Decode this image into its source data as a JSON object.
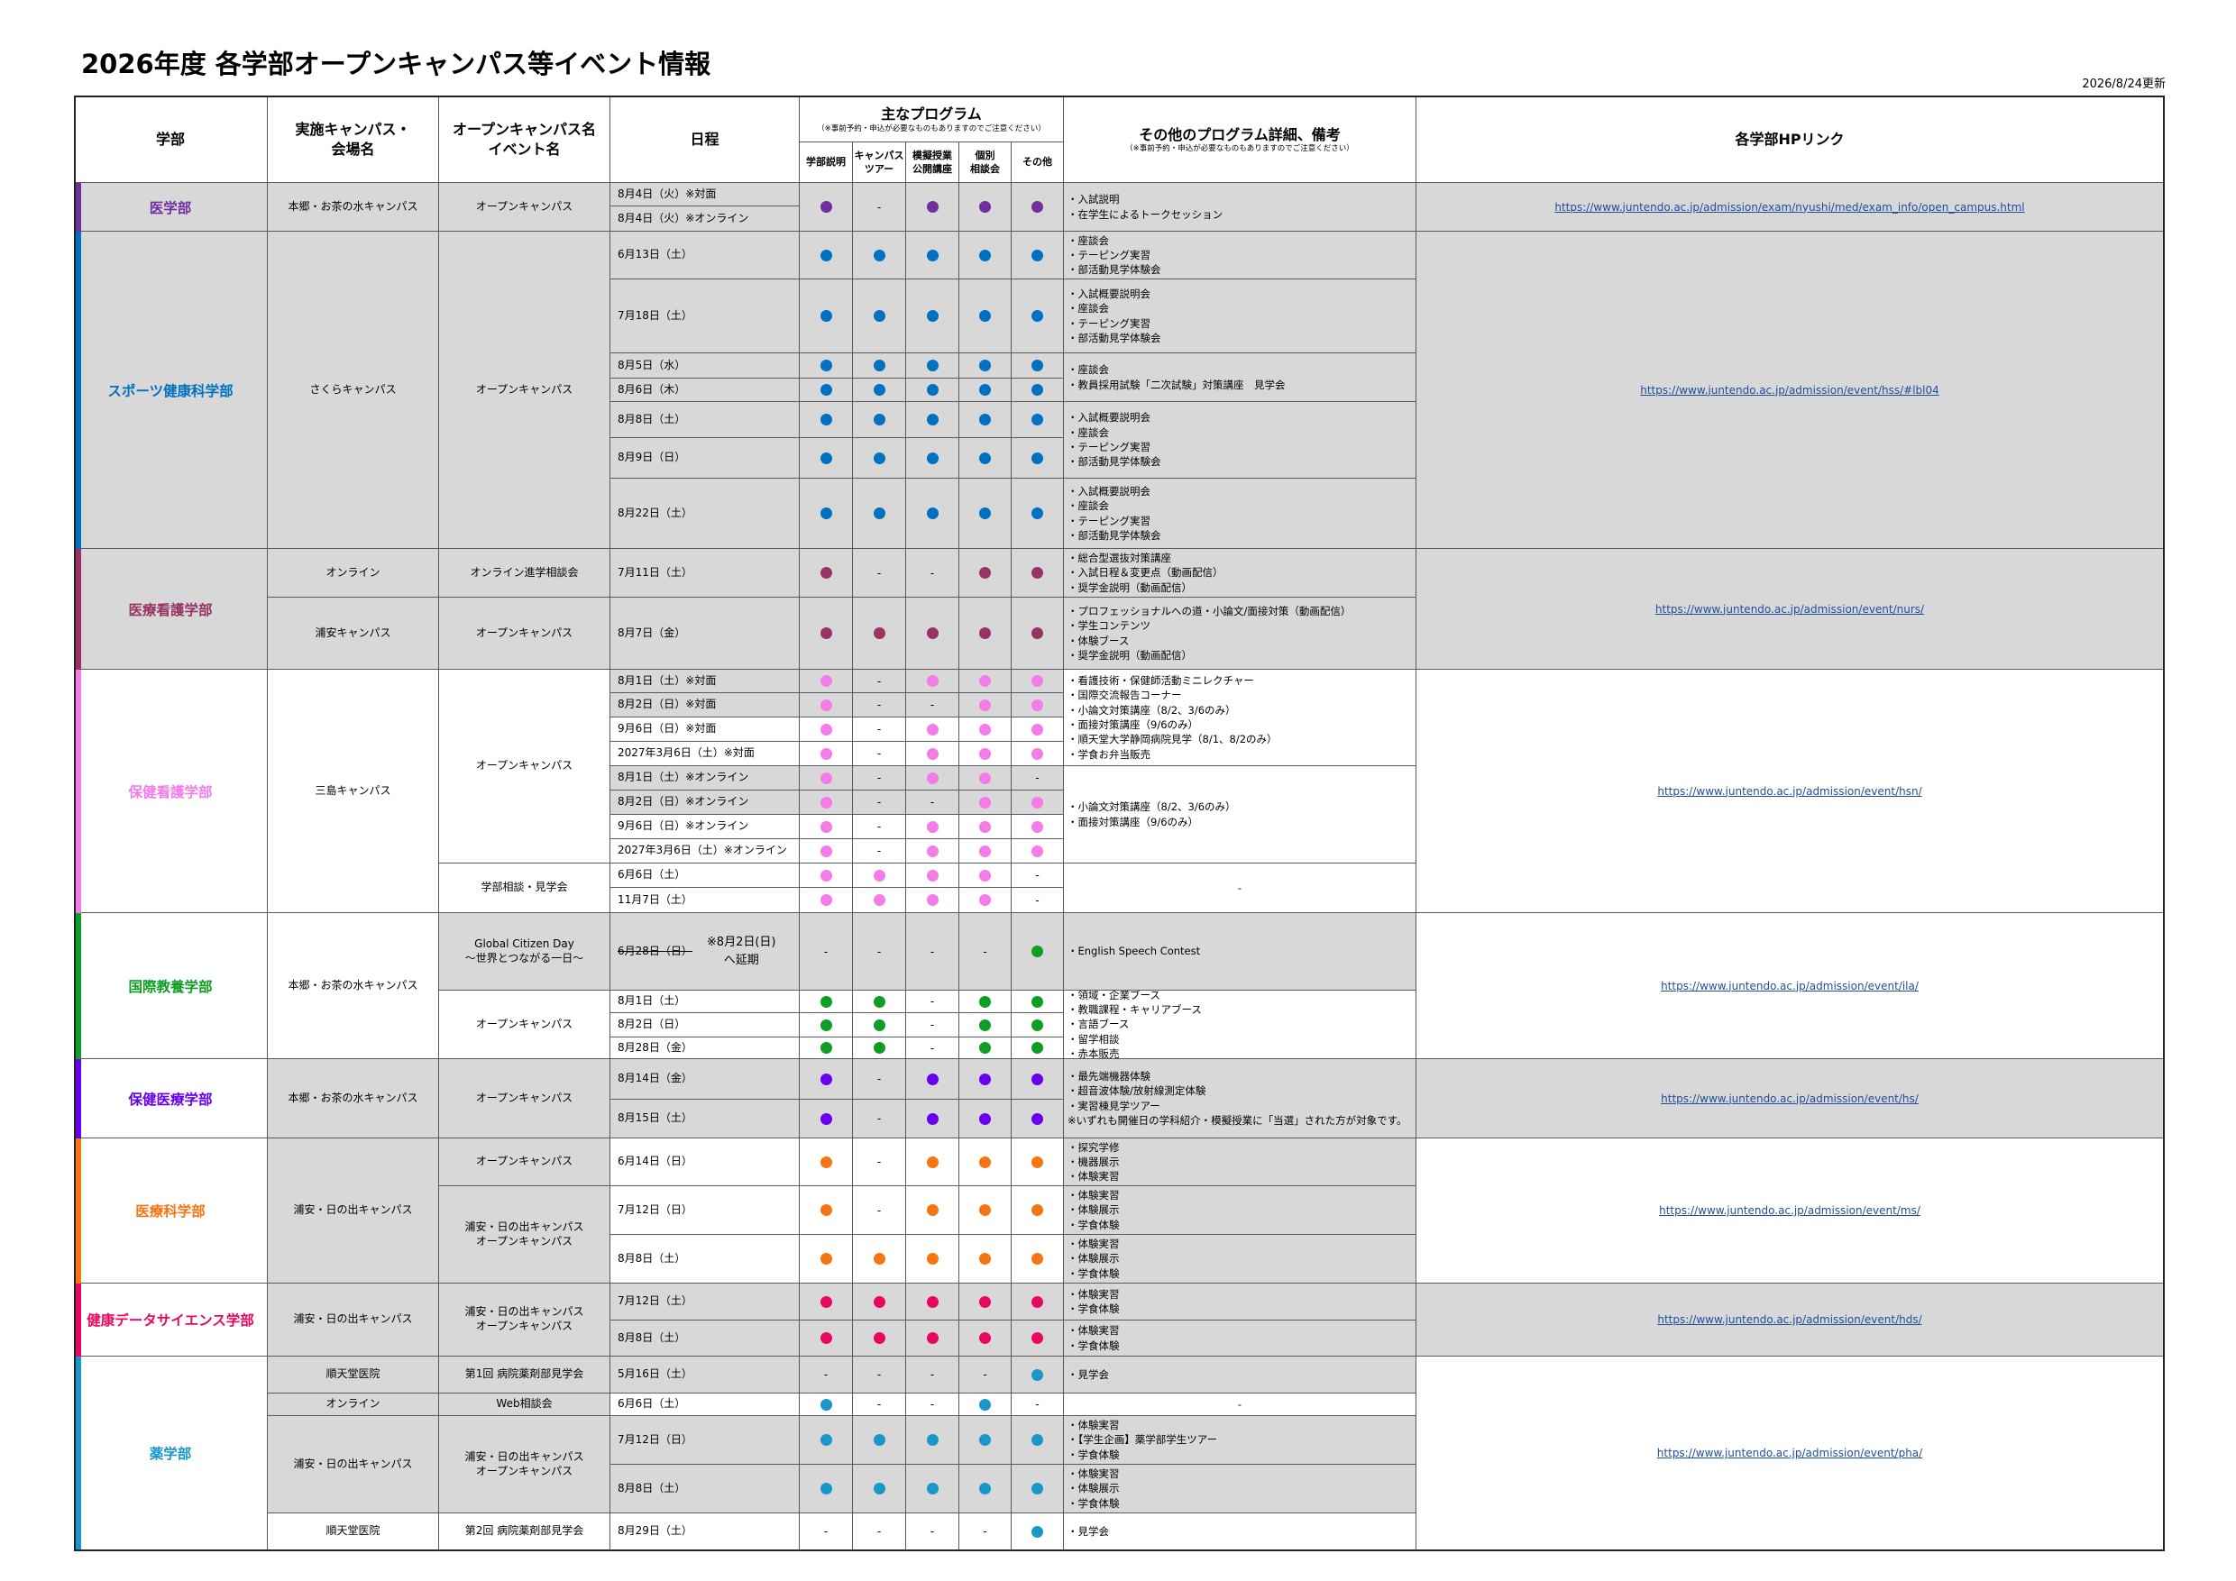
{
  "title": "2026年度 各学部オープンキャンパス等イベント情報",
  "updated": "2026/8/24更新",
  "headers": {
    "faculty": "学部",
    "campus": "実施キャンパス・\n会場名",
    "event": "オープンキャンパス名\nイベント名",
    "date": "日程",
    "programs": "主なプログラム",
    "programs_note": "（※事前予約・申込が必要なものもありますのでご注意ください）",
    "sub": [
      "学部説明",
      "キャンパス\nツアー",
      "模擬授業\n公開講座",
      "個別\n相談会",
      "その他"
    ],
    "notes": "その他のプログラム詳細、備考",
    "notes_note": "（※事前予約・申込が必要なものもありますのでご注意ください）",
    "link": "各学部HPリンク"
  },
  "colors": {
    "igaku": "#7030a0",
    "sports": "#0070c0",
    "iryokango": "#993366",
    "hokenkango": "#f37ce8",
    "kokusai": "#0d9e23",
    "hokeniryo": "#6600ee",
    "iryokagaku": "#f57514",
    "data": "#e8085f",
    "yaku": "#1997c8"
  },
  "faculties": [
    {
      "key": "igaku",
      "name": "医学部",
      "link": "https://www.juntendo.ac.jp/admission/exam/nyushi/med/exam_info/open_campus.html"
    },
    {
      "key": "sports",
      "name": "スポーツ健康科学部",
      "link": "https://www.juntendo.ac.jp/admission/event/hss/#lbl04"
    },
    {
      "key": "iryokango",
      "name": "医療看護学部",
      "link": "https://www.juntendo.ac.jp/admission/event/nurs/"
    },
    {
      "key": "hokenkango",
      "name": "保健看護学部",
      "link": "https://www.juntendo.ac.jp/admission/event/hsn/"
    },
    {
      "key": "kokusai",
      "name": "国際教養学部",
      "link": "https://www.juntendo.ac.jp/admission/event/ila/"
    },
    {
      "key": "hokeniryo",
      "name": "保健医療学部",
      "link": "https://www.juntendo.ac.jp/admission/event/hs/"
    },
    {
      "key": "iryokagaku",
      "name": "医療科学部",
      "link": "https://www.juntendo.ac.jp/admission/event/ms/"
    },
    {
      "key": "data",
      "name": "健康データサイエンス学部",
      "link": "https://www.juntendo.ac.jp/admission/event/hds/"
    },
    {
      "key": "yaku",
      "name": "薬学部",
      "link": "https://www.juntendo.ac.jp/admission/event/pha/"
    }
  ],
  "campuses": [
    "本郷・お茶の水キャンパス",
    "さくらキャンパス",
    "オンライン",
    "浦安キャンパス",
    "三島キャンパス",
    "本郷・お茶の水キャンパス",
    "本郷・お茶の水キャンパス",
    "浦安・日の出キャンパス",
    "浦安・日の出キャンパス",
    "順天堂医院",
    "オンライン",
    "浦安・日の出キャンパス",
    "順天堂医院"
  ],
  "events": [
    "オープンキャンパス",
    "オープンキャンパス",
    "オンライン進学相談会",
    "オープンキャンパス",
    "オープンキャンパス",
    "学部相談・見学会",
    "Global Citizen Day\n～世界とつながる一日～",
    "オープンキャンパス",
    "オープンキャンパス",
    "オープンキャンパス",
    "浦安・日の出キャンパス\nオープンキャンパス",
    "浦安・日の出キャンパス\nオープンキャンパス",
    "第1回 病院薬剤部見学会",
    "Web相談会",
    "浦安・日の出キャンパス\nオープンキャンパス",
    "第2回 病院薬剤部見学会"
  ],
  "postponed": {
    "old": "6月28日（日）",
    "new": "※8月2日(日)\nへ延期"
  },
  "rows": [
    {
      "date": "8月4日（火）※対面",
      "p": [
        "d",
        "-",
        "d",
        "d",
        "d"
      ]
    },
    {
      "date": "8月4日（火）※オンライン",
      "p": []
    },
    {
      "date": "6月13日（土）",
      "p": [
        "d",
        "d",
        "d",
        "d",
        "d"
      ]
    },
    {
      "date": "7月18日（土）",
      "p": [
        "d",
        "d",
        "d",
        "d",
        "d"
      ]
    },
    {
      "date": "8月5日（水）",
      "p": [
        "d",
        "d",
        "d",
        "d",
        "d"
      ]
    },
    {
      "date": "8月6日（木）",
      "p": [
        "d",
        "d",
        "d",
        "d",
        "d"
      ]
    },
    {
      "date": "8月8日（土）",
      "p": [
        "d",
        "d",
        "d",
        "d",
        "d"
      ]
    },
    {
      "date": "8月9日（日）",
      "p": [
        "d",
        "d",
        "d",
        "d",
        "d"
      ]
    },
    {
      "date": "8月22日（土）",
      "p": [
        "d",
        "d",
        "d",
        "d",
        "d"
      ]
    },
    {
      "date": "7月11日（土）",
      "p": [
        "d",
        "-",
        "-",
        "d",
        "d"
      ]
    },
    {
      "date": "8月7日（金）",
      "p": [
        "d",
        "d",
        "d",
        "d",
        "d"
      ]
    },
    {
      "date": "8月1日（土）※対面",
      "p": [
        "d",
        "-",
        "d",
        "d",
        "d"
      ]
    },
    {
      "date": "8月2日（日）※対面",
      "p": [
        "d",
        "-",
        "-",
        "d",
        "d"
      ]
    },
    {
      "date": "9月6日（日）※対面",
      "p": [
        "d",
        "-",
        "d",
        "d",
        "d"
      ]
    },
    {
      "date": "2027年3月6日（土）※対面",
      "p": [
        "d",
        "-",
        "d",
        "d",
        "d"
      ]
    },
    {
      "date": "8月1日（土）※オンライン",
      "p": [
        "d",
        "-",
        "d",
        "d",
        "-"
      ]
    },
    {
      "date": "8月2日（日）※オンライン",
      "p": [
        "d",
        "-",
        "-",
        "d",
        "d"
      ]
    },
    {
      "date": "9月6日（日）※オンライン",
      "p": [
        "d",
        "-",
        "d",
        "d",
        "d"
      ]
    },
    {
      "date": "2027年3月6日（土）※オンライン",
      "p": [
        "d",
        "-",
        "d",
        "d",
        "d"
      ]
    },
    {
      "date": "6月6日（土）",
      "p": [
        "d",
        "d",
        "d",
        "d",
        "-"
      ]
    },
    {
      "date": "11月7日（土）",
      "p": [
        "d",
        "d",
        "d",
        "d",
        "-"
      ]
    },
    {
      "date": "",
      "p": [
        "-",
        "-",
        "-",
        "-",
        "d"
      ]
    },
    {
      "date": "8月1日（土）",
      "p": [
        "d",
        "d",
        "-",
        "d",
        "d"
      ]
    },
    {
      "date": "8月2日（日）",
      "p": [
        "d",
        "d",
        "-",
        "d",
        "d"
      ]
    },
    {
      "date": "8月28日（金）",
      "p": [
        "d",
        "d",
        "-",
        "d",
        "d"
      ]
    },
    {
      "date": "8月14日（金）",
      "p": [
        "d",
        "-",
        "d",
        "d",
        "d"
      ]
    },
    {
      "date": "8月15日（土）",
      "p": [
        "d",
        "-",
        "d",
        "d",
        "d"
      ]
    },
    {
      "date": "6月14日（日）",
      "p": [
        "d",
        "-",
        "d",
        "d",
        "d"
      ]
    },
    {
      "date": "7月12日（日）",
      "p": [
        "d",
        "-",
        "d",
        "d",
        "d"
      ]
    },
    {
      "date": "8月8日（土）",
      "p": [
        "d",
        "d",
        "d",
        "d",
        "d"
      ]
    },
    {
      "date": "7月12日（土）",
      "p": [
        "d",
        "d",
        "d",
        "d",
        "d"
      ]
    },
    {
      "date": "8月8日（土）",
      "p": [
        "d",
        "d",
        "d",
        "d",
        "d"
      ]
    },
    {
      "date": "5月16日（土）",
      "p": [
        "-",
        "-",
        "-",
        "-",
        "d"
      ]
    },
    {
      "date": "6月6日（土）",
      "p": [
        "d",
        "-",
        "-",
        "d",
        "-"
      ]
    },
    {
      "date": "7月12日（日）",
      "p": [
        "d",
        "d",
        "d",
        "d",
        "d"
      ]
    },
    {
      "date": "8月8日（土）",
      "p": [
        "d",
        "d",
        "d",
        "d",
        "d"
      ]
    },
    {
      "date": "8月29日（土）",
      "p": [
        "-",
        "-",
        "-",
        "-",
        "d"
      ]
    }
  ],
  "notes": [
    "・入試説明\n・在学生によるトークセッション",
    "・座談会\n・テーピング実習\n・部活動見学体験会",
    "・入試概要説明会\n・座談会\n・テーピング実習\n・部活動見学体験会",
    "・座談会\n・教員採用試験「二次試験」対策講座　見学会",
    "・入試概要説明会\n・座談会\n・テーピング実習\n・部活動見学体験会",
    "・入試概要説明会\n・座談会\n・テーピング実習\n・部活動見学体験会",
    "・総合型選抜対策講座\n・入試日程＆変更点（動画配信）\n・奨学金説明（動画配信）",
    "・プロフェッショナルへの道・小論文/面接対策（動画配信）\n・学生コンテンツ\n・体験ブース\n・奨学金説明（動画配信）",
    "・看護技術・保健師活動ミニレクチャー\n・国際交流報告コーナー\n・小論文対策講座（8/2、3/6のみ）\n・面接対策講座（9/6のみ）\n・順天堂大学静岡病院見学（8/1、8/2のみ）\n・学食お弁当販売",
    "・小論文対策講座（8/2、3/6のみ）\n・面接対策講座（9/6のみ）",
    "-",
    "・English Speech Contest",
    "・領域・企業ブース\n・教職課程・キャリアブース\n・言語ブース\n・留学相談\n・赤本販売",
    "・最先端機器体験\n・超音波体験/放射線測定体験\n・実習棟見学ツアー\n※いずれも開催日の学科紹介・模擬授業に「当選」された方が対象です。",
    "・探究学修\n・機器展示\n・体験実習",
    "・体験実習\n・体験展示\n・学食体験",
    "・体験実習\n・体験展示\n・学食体験",
    "・体験実習\n・学食体験",
    "・体験実習\n・学食体験",
    "・見学会",
    "-",
    "・体験実習\n・【学生企画】薬学部学生ツアー\n・学食体験",
    "・体験実習\n・体験展示\n・学食体験",
    "・見学会"
  ]
}
